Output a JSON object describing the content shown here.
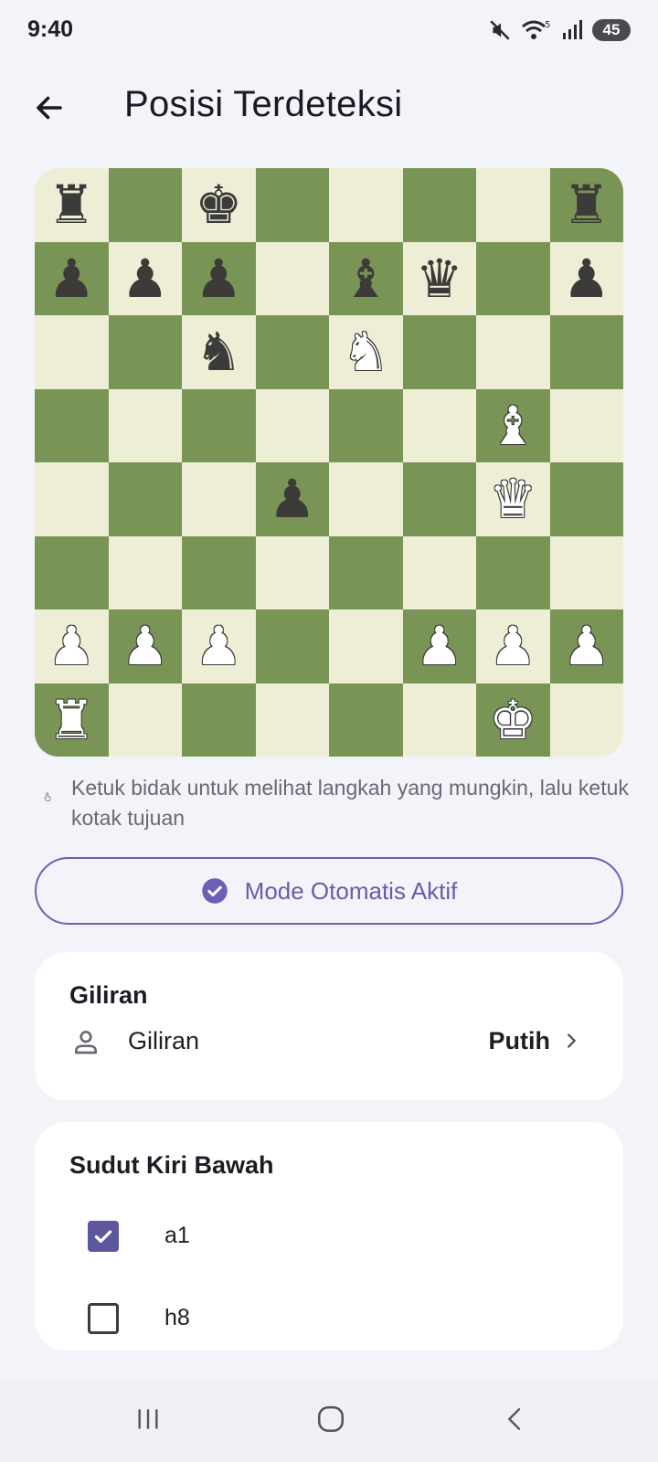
{
  "status_bar": {
    "time": "9:40",
    "battery": "45"
  },
  "header": {
    "title": "Posisi Terdeteksi"
  },
  "board": {
    "light_color": "#edeed5",
    "dark_color": "#799555",
    "rows": [
      [
        "br",
        "",
        "bk",
        "",
        "",
        "",
        "",
        "br"
      ],
      [
        "bp",
        "bp",
        "bp",
        "",
        "bb",
        "bq",
        "",
        "bp"
      ],
      [
        "",
        "",
        "bn",
        "",
        "wn",
        "",
        "",
        ""
      ],
      [
        "",
        "",
        "",
        "",
        "",
        "",
        "wb",
        ""
      ],
      [
        "",
        "",
        "",
        "bp",
        "",
        "",
        "wq",
        ""
      ],
      [
        "",
        "",
        "",
        "",
        "",
        "",
        "",
        ""
      ],
      [
        "wp",
        "wp",
        "wp",
        "",
        "",
        "wp",
        "wp",
        "wp"
      ],
      [
        "wr",
        "",
        "",
        "",
        "",
        "",
        "wk",
        ""
      ]
    ]
  },
  "hint": {
    "text": "Ketuk bidak untuk melihat langkah yang mungkin, lalu ketuk kotak tujuan"
  },
  "mode_button": {
    "label": "Mode Otomatis Aktif",
    "color": "#6d5fb8"
  },
  "turn_card": {
    "title": "Giliran",
    "row_label": "Giliran",
    "row_value": "Putih"
  },
  "corner_card": {
    "title": "Sudut Kiri Bawah",
    "options": [
      {
        "label": "a1",
        "checked": true
      },
      {
        "label": "h8",
        "checked": false
      }
    ]
  }
}
